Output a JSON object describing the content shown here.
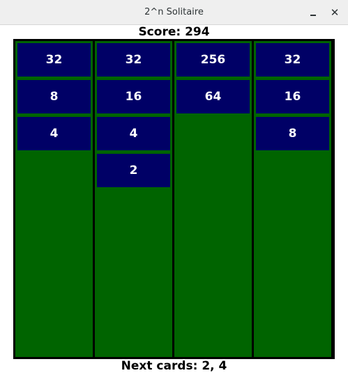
{
  "window": {
    "title": "2^n Solitaire",
    "minimize_icon": "minimize-icon",
    "close_icon": "close-icon",
    "close_glyph": "✕"
  },
  "score_text": "Score: 294",
  "next_cards_text": "Next cards: 2, 4",
  "colors": {
    "board_bg": "#000000",
    "column_bg": "#006400",
    "card_bg": "#000066",
    "card_text": "#ffffff"
  },
  "columns": [
    {
      "cards": [
        "32",
        "8",
        "4"
      ]
    },
    {
      "cards": [
        "32",
        "16",
        "4",
        "2"
      ]
    },
    {
      "cards": [
        "256",
        "64"
      ]
    },
    {
      "cards": [
        "32",
        "16",
        "8"
      ]
    }
  ]
}
